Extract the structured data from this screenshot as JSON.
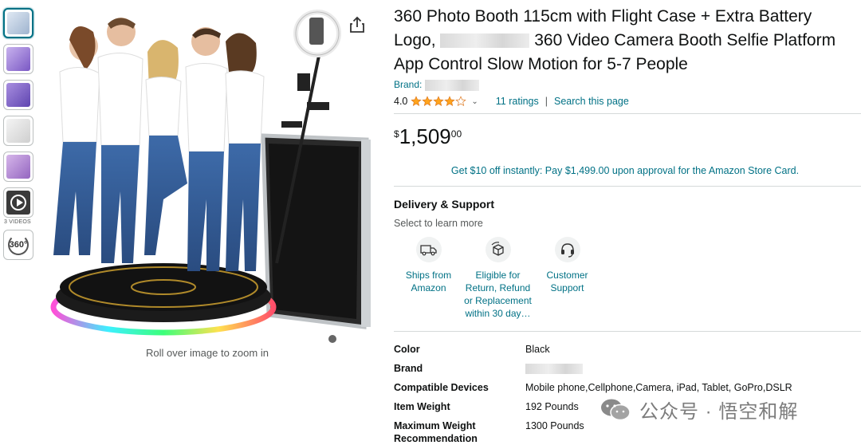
{
  "thumbnails": {
    "videos_label": "3 VIDEOS",
    "view_360_label": "360°",
    "items": [
      {
        "kind": "image",
        "tone": "#c9d7e8"
      },
      {
        "kind": "image",
        "tone": "#9b7bd4"
      },
      {
        "kind": "image",
        "tone": "#7f66c9"
      },
      {
        "kind": "image",
        "tone": "#e7e7e7"
      },
      {
        "kind": "image",
        "tone": "#b48ad0"
      },
      {
        "kind": "video",
        "tone": "#333333"
      }
    ]
  },
  "main_image": {
    "zoom_hint": "Roll over image to zoom in"
  },
  "product": {
    "title_line1": "360 Photo Booth 115cm with Flight Case + Extra Battery",
    "title_line2_a": "Logo,",
    "title_line2_b": "360 Video Camera Booth Selfie Platform",
    "title_line3": "App Control Slow Motion for 5-7 People",
    "brand_label": "Brand:",
    "rating_value": "4.0",
    "rating_stars": 4,
    "ratings_count": "11 ratings",
    "search_page": "Search this page",
    "price_symbol": "$",
    "price_whole": "1,509",
    "price_fraction": "00",
    "card_offer": "Get $10 off instantly: Pay $1,499.00 upon approval for the Amazon Store Card."
  },
  "delivery": {
    "title": "Delivery & Support",
    "subtitle": "Select to learn more",
    "features": [
      {
        "icon": "truck-icon",
        "label": "Ships from Amazon"
      },
      {
        "icon": "return-box-icon",
        "label": "Eligible for Return, Refund or Replacement within 30 day…"
      },
      {
        "icon": "headset-icon",
        "label": "Customer Support"
      }
    ]
  },
  "specs": [
    {
      "key": "Color",
      "value": "Black"
    },
    {
      "key": "Brand",
      "value": ""
    },
    {
      "key": "Compatible Devices",
      "value": "Mobile phone,Cellphone,Camera, iPad, Tablet, GoPro,DSLR"
    },
    {
      "key": "Item Weight",
      "value": "192 Pounds"
    },
    {
      "key": "Maximum Weight Recommendation",
      "value": "1300 Pounds"
    }
  ],
  "watermark": {
    "text": "公众号 · 悟空和解"
  },
  "colors": {
    "link": "#007185",
    "star": "#ffa41c",
    "ring_light": "#ff4fd8"
  }
}
